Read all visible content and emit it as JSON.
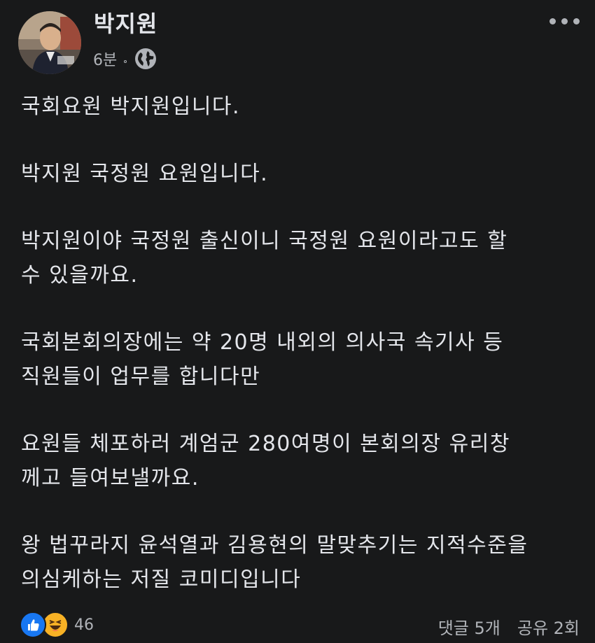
{
  "author": {
    "name": "박지원"
  },
  "meta": {
    "time": "6분",
    "privacy_icon": "globe-icon"
  },
  "menu": {
    "icon": "more-horizontal-icon"
  },
  "post": {
    "paragraphs": [
      "국회요원 박지원입니다.",
      "박지원 국정원 요원입니다.",
      "박지원이야 국정원 출신이니 국정원 요원이라고도 할\n수 있을까요.",
      "국회본회의장에는 약 20명 내외의 의사국 속기사 등\n직원들이 업무를 합니다만",
      "요원들 체포하러 계엄군 280여명이 본회의장 유리창\n께고 들여보낼까요.",
      "왕 법꾸라지 윤석열과 김용현의 말맞추기는 지적수준을\n의심케하는 저질 코미디입니다"
    ]
  },
  "reactions": {
    "icons": [
      "like-icon",
      "haha-icon"
    ],
    "count": "46"
  },
  "stats": {
    "comments": "댓글 5개",
    "shares": "공유 2회"
  },
  "colors": {
    "background": "#18191a",
    "text": "#e4e6eb",
    "secondary": "#b0b3b8",
    "like_blue": "#1877f2",
    "haha_yellow": "#f7b125"
  }
}
